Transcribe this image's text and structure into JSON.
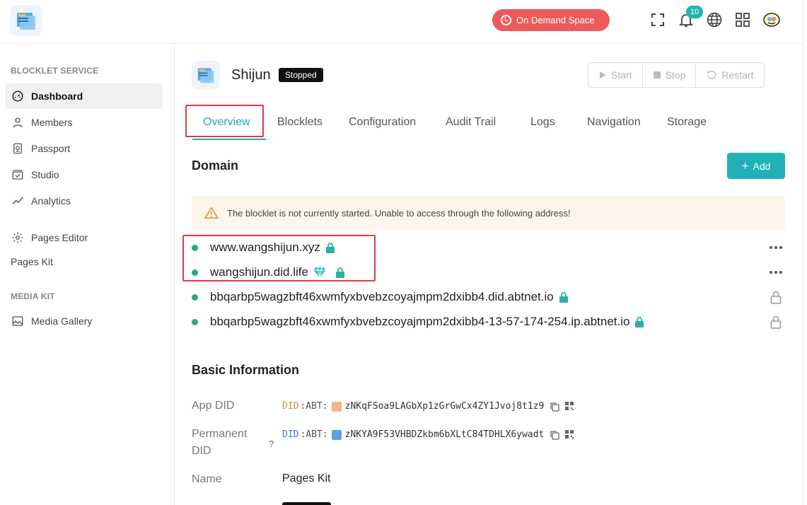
{
  "topbar": {
    "space_label": "On Demand Space",
    "notification_count": "10",
    "icons": [
      "fullscreen-icon",
      "bell-icon",
      "globe-icon",
      "apps-grid-icon",
      "user-avatar"
    ]
  },
  "sidebar": {
    "section_service": "BLOCKLET SERVICE",
    "items": [
      {
        "label": "Dashboard",
        "icon": "dashboard-icon",
        "active": true
      },
      {
        "label": "Members",
        "icon": "user-icon"
      },
      {
        "label": "Passport",
        "icon": "passport-icon"
      },
      {
        "label": "Studio",
        "icon": "studio-icon"
      },
      {
        "label": "Analytics",
        "icon": "analytics-icon"
      }
    ],
    "pages_editor": "Pages Editor",
    "pages_kit": "Pages Kit",
    "section_media": "MEDIA KIT",
    "media_gallery": "Media Gallery"
  },
  "header": {
    "app_name": "Shijun",
    "status": "Stopped",
    "actions": {
      "start": "Start",
      "stop": "Stop",
      "restart": "Restart"
    }
  },
  "tabs": [
    "Overview",
    "Blocklets",
    "Configuration",
    "Audit Trail",
    "Logs",
    "Navigation",
    "Storage"
  ],
  "domain": {
    "title": "Domain",
    "add_label": "Add",
    "warning": "The blocklet is not currently started. Unable to access through the following address!",
    "entries": [
      {
        "host": "www.wangshijun.xyz"
      },
      {
        "host": "wangshijun.did.life"
      },
      {
        "host": "bbqarbp5wagzbft46xwmfyxbvebzcoyajmpm2dxibb4.did.abtnet.io"
      },
      {
        "host": "bbqarbp5wagzbft46xwmfyxbvebzcoyajmpm2dxibb4-13-57-174-254.ip.abtnet.io"
      }
    ]
  },
  "basic_info": {
    "title": "Basic Information",
    "app_did_label": "App DID",
    "permanent_did_label_1": "Permanent",
    "permanent_did_label_2": "DID",
    "help_mark": "?",
    "name_label": "Name",
    "name_value": "Pages Kit",
    "did_prefix": "DID",
    "did_mid": ":ABT:",
    "app_did": "zNKqFSoa9LAGbXp1zGrGwCx4ZY1Jvoj8t1z9",
    "permanent_did": "zNKYA9F53VHBDZkbm6bXLtC84TDHLX6ywadt"
  },
  "colors": {
    "accent": "#22a7b7",
    "danger": "#ec5b5b",
    "success": "#2aa58a",
    "warning_bg": "#fdf5e9"
  }
}
